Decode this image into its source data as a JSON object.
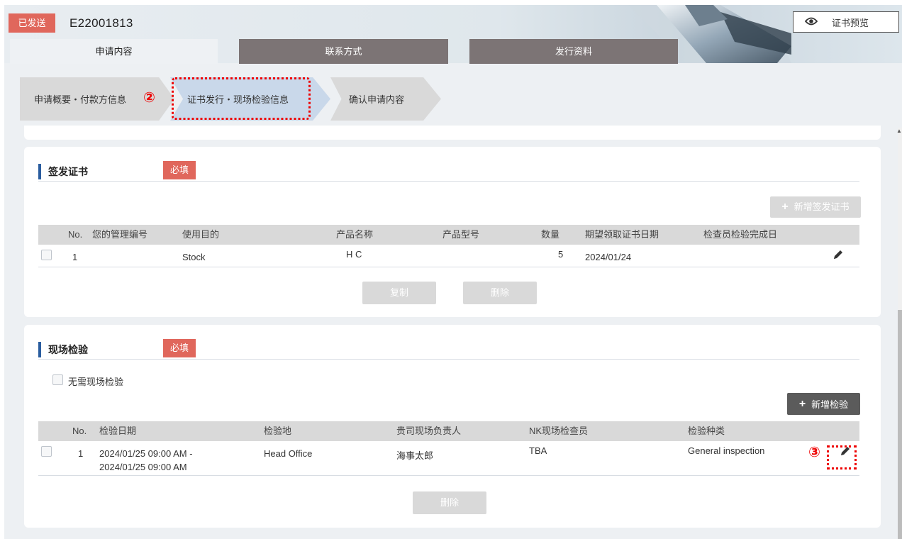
{
  "header": {
    "status_badge": "已发送",
    "app_id": "E22001813",
    "preview_label": "证书预览"
  },
  "tabs": [
    "申请内容",
    "联系方式",
    "发行资料"
  ],
  "steps": [
    "申请概要・付款方信息",
    "证书发行・现场检验信息",
    "确认申请内容"
  ],
  "annotations": {
    "num2": "②",
    "num3": "③"
  },
  "certificates": {
    "title": "签发证书",
    "required": "必填",
    "add_button": "新增签发证书",
    "columns": [
      "No.",
      "您的管理编号",
      "使用目的",
      "产品名称",
      "产品型号",
      "数量",
      "期望领取证书日期",
      "检查员检验完成日"
    ],
    "rows": [
      {
        "no": "1",
        "mgmt_no": "",
        "purpose": "Stock",
        "product_name": "H C",
        "model": "",
        "quantity": "5",
        "desired_date": "2024/01/24",
        "completion_date": ""
      }
    ],
    "copy_button": "复制",
    "delete_button": "删除"
  },
  "inspection": {
    "title": "现场检验",
    "required": "必填",
    "no_inspection_label": "无需现场检验",
    "add_button": "新增检验",
    "columns": [
      "No.",
      "检验日期",
      "检验地",
      "贵司现场负责人",
      "NK现场检查员",
      "检验种类"
    ],
    "rows": [
      {
        "no": "1",
        "date_start": "2024/01/25 09:00 AM -",
        "date_end": "2024/01/25 09:00 AM",
        "place": "Head Office",
        "person": "海事太郎",
        "inspector": "TBA",
        "type": "General inspection"
      }
    ],
    "delete_button": "删除"
  },
  "colors": {
    "accent": "#2a5d9f",
    "required": "#e0675c",
    "tab_inactive": "#7c7475",
    "annotation": "#ee0000"
  }
}
